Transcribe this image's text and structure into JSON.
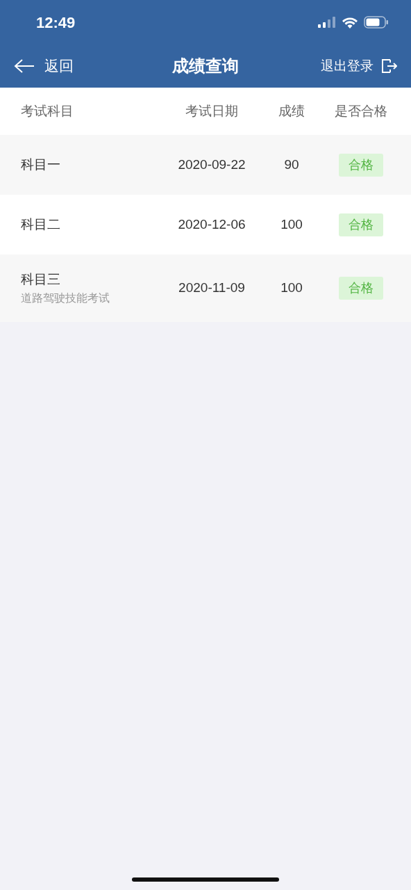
{
  "status_bar": {
    "time": "12:49"
  },
  "nav": {
    "back": "返回",
    "title": "成绩查询",
    "logout": "退出登录"
  },
  "table": {
    "columns": [
      "考试科目",
      "考试日期",
      "成绩",
      "是否合格"
    ],
    "rows": [
      {
        "subject": "科目一",
        "date": "2020-09-22",
        "score": "90",
        "result": "合格",
        "passed": true
      },
      {
        "subject": "科目二",
        "date": "2020-12-06",
        "score": "100",
        "result": "合格",
        "passed": true
      },
      {
        "subject": "科目三",
        "note": "道路驾驶技能考试",
        "date": "2020-11-09",
        "score": "100",
        "result": "合格",
        "passed": true
      }
    ]
  }
}
